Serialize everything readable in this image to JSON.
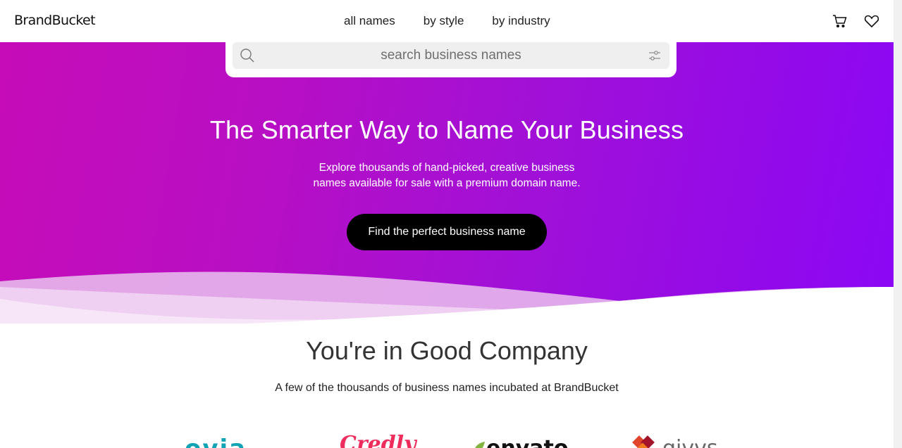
{
  "header": {
    "logo": "BrandBucket",
    "nav": [
      "all names",
      "by style",
      "by industry"
    ],
    "icons": {
      "cart": "cart-icon",
      "favorites": "heart-icon"
    }
  },
  "search": {
    "placeholder": "search business names",
    "value": ""
  },
  "hero": {
    "title": "The Smarter Way to Name Your Business",
    "subtitle_line1": "Explore thousands of hand-picked, creative business",
    "subtitle_line2": "names available for sale with a premium domain name.",
    "cta": "Find the perfect business name",
    "gradient": [
      "#c60cb8",
      "#8b07f5"
    ]
  },
  "company": {
    "title": "You're in Good Company",
    "subtitle": "A few of the thousands of business names incubated at BrandBucket",
    "logos": [
      "ovia",
      "Credly",
      "envato",
      "givvs"
    ]
  }
}
